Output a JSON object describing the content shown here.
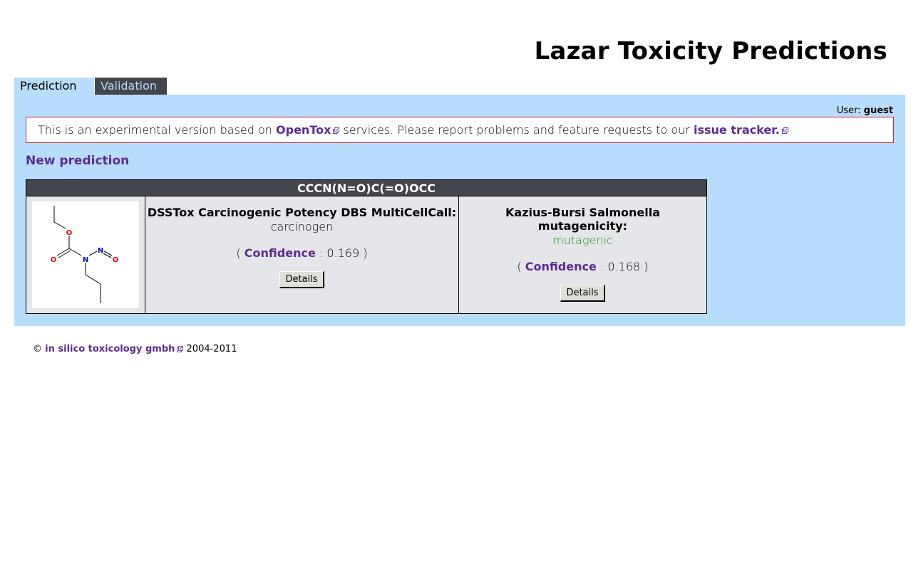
{
  "header": {
    "title": "Lazar Toxicity Predictions"
  },
  "tabs": [
    {
      "label": "Prediction",
      "active": true
    },
    {
      "label": "Validation",
      "active": false
    }
  ],
  "user": {
    "label": "User:",
    "name": "guest"
  },
  "notice": {
    "text_before": "This is an experimental version based on",
    "link1": "OpenTox",
    "text_middle": "services. Please report problems and feature requests to our",
    "link2": "issue tracker."
  },
  "new_prediction_link": "New prediction",
  "prediction": {
    "smiles": "CCCN(N=O)C(=O)OCC",
    "molecule_atoms": {
      "o1": "O",
      "o2": "O",
      "n1": "N",
      "n2": "N",
      "o3": "O"
    },
    "models": [
      {
        "title": "DSSTox Carcinogenic Potency DBS MultiCellCall:",
        "result": "carcinogen",
        "result_color": "#000000",
        "paren_open": "(",
        "confidence_label": "Confidence",
        "confidence_sep": ":",
        "confidence": "0.169",
        "paren_close": ")",
        "button": "Details"
      },
      {
        "title": "Kazius-Bursi Salmonella mutagenicity:",
        "result": "mutagenic",
        "result_color": "#1a8a1a",
        "paren_open": "(",
        "confidence_label": "Confidence",
        "confidence_sep": ":",
        "confidence": "0.168",
        "paren_close": ")",
        "button": "Details"
      }
    ]
  },
  "footer": {
    "copyright": "©",
    "company": "in silico toxicology gmbh",
    "years": "2004-2011"
  },
  "colors": {
    "accent_link": "#5a2d91",
    "panel_bg": "#b8dcfc",
    "tab_dark": "#42454a",
    "notice_border": "#cc2233"
  }
}
